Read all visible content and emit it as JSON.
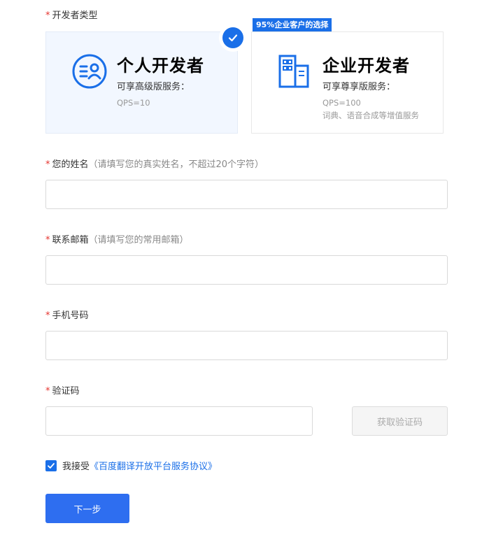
{
  "developer_type": {
    "label": "开发者类型",
    "badge": "95%企业客户的选择",
    "cards": [
      {
        "title": "个人开发者",
        "subtitle": "可享高级版服务：",
        "lines": [
          "QPS=10"
        ],
        "selected": true,
        "icon": "person-id-icon"
      },
      {
        "title": "企业开发者",
        "subtitle": "可享尊享版服务：",
        "lines": [
          "QPS=100",
          "词典、语音合成等增值服务"
        ],
        "selected": false,
        "icon": "building-icon"
      }
    ]
  },
  "fields": {
    "name": {
      "label": "您的姓名",
      "hint": "（请填写您的真实姓名，不超过20个字符）",
      "value": "",
      "placeholder": ""
    },
    "email": {
      "label": "联系邮箱",
      "hint": "（请填写您的常用邮箱）",
      "value": "",
      "placeholder": ""
    },
    "phone": {
      "label": "手机号码",
      "value": "",
      "placeholder": ""
    },
    "code": {
      "label": "验证码",
      "value": "",
      "placeholder": "",
      "button": "获取验证码"
    }
  },
  "required_mark": "*",
  "agreement": {
    "prefix": "我接受",
    "link": "《百度翻译开放平台服务协议》",
    "checked": true
  },
  "next_button": "下一步",
  "colors": {
    "accent": "#1a6fe8",
    "required": "#e5322d"
  }
}
